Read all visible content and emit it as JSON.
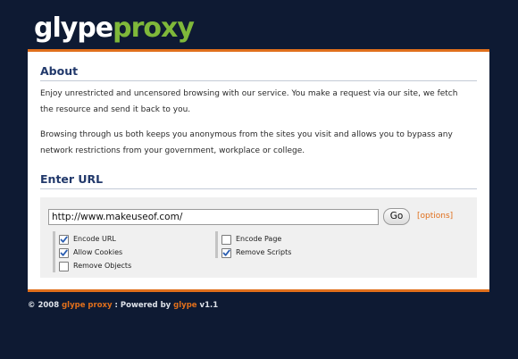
{
  "logo": {
    "part1": "glype",
    "part2": "proxy"
  },
  "about": {
    "title": "About",
    "paragraph1": "Enjoy unrestricted and uncensored browsing with our service. You make a request via our site, we fetch the resource and send it back to you.",
    "paragraph2": "Browsing through us both keeps you anonymous from the sites you visit and allows you to bypass any network restrictions from your government, workplace or college."
  },
  "enter_url": {
    "title": "Enter URL",
    "url_value": "http://www.makeuseof.com/",
    "go_label": "Go",
    "options_open": "[",
    "options_label": "options",
    "options_close": "]"
  },
  "options_left": [
    {
      "label": "Encode URL",
      "checked": true
    },
    {
      "label": "Allow Cookies",
      "checked": true
    },
    {
      "label": "Remove Objects",
      "checked": false
    }
  ],
  "options_right": [
    {
      "label": "Encode Page",
      "checked": false
    },
    {
      "label": "Remove Scripts",
      "checked": true
    }
  ],
  "footer": {
    "prefix": "© 2008 ",
    "brand": "glype proxy",
    "middle": " : Powered by ",
    "powered": "glype",
    "version": " v1.1"
  },
  "colors": {
    "background": "#0e1a33",
    "accent_orange": "#e06f1c",
    "logo_green": "#7fb83a",
    "heading_blue": "#22396b"
  }
}
